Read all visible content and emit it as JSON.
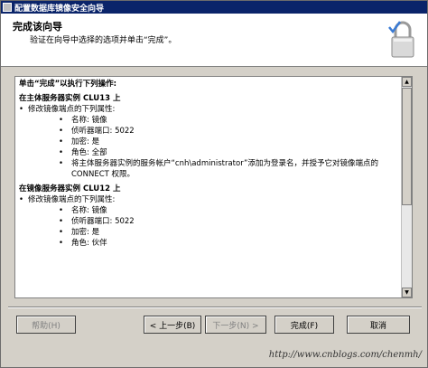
{
  "window": {
    "title": "配置数据库镜像安全向导"
  },
  "header": {
    "title": "完成该向导",
    "subtitle": "验证在向导中选择的选项并单击“完成”。"
  },
  "icons": {
    "app": "app-icon",
    "lock": "lock-icon"
  },
  "summary": {
    "intro": "单击“完成”以执行下列操作:",
    "sections": [
      {
        "heading": "在主体服务器实例 CLU13 上",
        "item": "修改镜像端点的下列属性:",
        "props": [
          "名称: 镜像",
          "侦听器端口: 5022",
          "加密: 是",
          "角色: 全部"
        ],
        "login_line1": "将主体服务器实例的服务帐户“cnh\\administrator”添加为登录名，并授予它对镜像端点的",
        "login_line2": "CONNECT 权限。"
      },
      {
        "heading": "在镜像服务器实例 CLU12 上",
        "item": "修改镜像端点的下列属性:",
        "props": [
          "名称: 镜像",
          "侦听器端口: 5022",
          "加密: 是",
          "角色: 伙伴"
        ]
      }
    ]
  },
  "buttons": {
    "help": "帮助(H)",
    "back": "< 上一步(B)",
    "next": "下一步(N) >",
    "finish": "完成(F)",
    "cancel": "取消"
  },
  "watermark": "http://www.cnblogs.com/chenmh/"
}
